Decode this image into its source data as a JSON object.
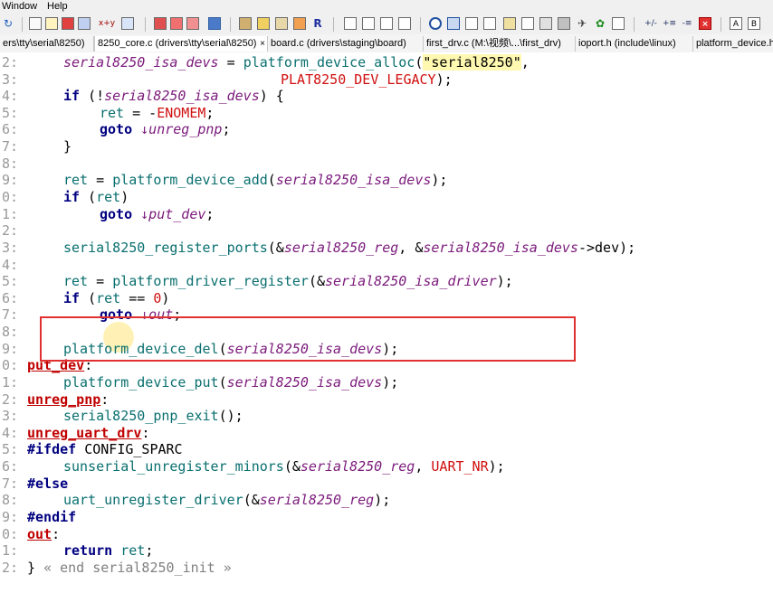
{
  "menu": {
    "items": [
      "Window",
      "Help"
    ]
  },
  "toolbar": {
    "redo_glyph": "↻",
    "swap_label": "x+y",
    "sort_label": "+/-",
    "text_a": "A",
    "text_b": "B"
  },
  "tabs": [
    {
      "label": "ers\\tty\\serial\\8250)"
    },
    {
      "label": "8250_core.c (drivers\\tty\\serial\\8250)",
      "close": "×"
    },
    {
      "label": "board.c (drivers\\staging\\board)"
    },
    {
      "label": "first_drv.c (M:\\视频\\...\\first_drv)"
    },
    {
      "label": "ioport.h (include\\linux)"
    },
    {
      "label": "platform_device.h"
    }
  ],
  "gutter": [
    "2:",
    "3:",
    "4:",
    "5:",
    "6:",
    "7:",
    "8:",
    "9:",
    "0:",
    "1:",
    "2:",
    "3:",
    "4:",
    "5:",
    "6:",
    "7:",
    "8:",
    "9:",
    "0:",
    "1:",
    "2:",
    "3:",
    "4:",
    "5:",
    "6:",
    "7:",
    "8:",
    "9:",
    "0:",
    "1:",
    "2:"
  ],
  "code": {
    "l1": {
      "a": "serial8250_isa_devs",
      "b": " = ",
      "c": "platform_device_alloc",
      "d": "(",
      "e": "\"serial8250\"",
      "f": ","
    },
    "l2": {
      "a": "PLAT8250_DEV_LEGACY",
      "b": ");"
    },
    "l3": {
      "a": "if",
      "b": " (!",
      "c": "serial8250_isa_devs",
      "d": ") {"
    },
    "l4": {
      "a": "ret",
      "b": " = -",
      "c": "ENOMEM",
      "d": ";"
    },
    "l5": {
      "a": "goto",
      "b": " ↓unreg_pnp",
      "c": ";"
    },
    "l6": {
      "a": "}"
    },
    "l8": {
      "a": "ret",
      "b": " = ",
      "c": "platform_device_add",
      "d": "(",
      "e": "serial8250_isa_devs",
      "f": ");"
    },
    "l9": {
      "a": "if",
      "b": " (",
      "c": "ret",
      "d": ")"
    },
    "l10": {
      "a": "goto",
      "b": " ↓put_dev",
      "c": ";"
    },
    "l12": {
      "a": "serial8250_register_ports",
      "b": "(&",
      "c": "serial8250_reg",
      "d": ", &",
      "e": "serial8250_isa_devs",
      "f": "->dev);"
    },
    "l14": {
      "a": "ret",
      "b": " = ",
      "c": "platform_driver_register",
      "d": "(&",
      "e": "serial8250_isa_driver",
      "f": ");"
    },
    "l15": {
      "a": "if",
      "b": " (",
      "c": "ret",
      "d": " == ",
      "e": "0",
      "f": ")"
    },
    "l16": {
      "a": "goto",
      "b": " ↓out",
      "c": ";"
    },
    "l18": {
      "a": "platform_device_del",
      "b": "(",
      "c": "serial8250_isa_devs",
      "d": ");"
    },
    "l19": {
      "a": "put_dev",
      "b": ":"
    },
    "l20": {
      "a": "platform_device_put",
      "b": "(",
      "c": "serial8250_isa_devs",
      "d": ");"
    },
    "l21": {
      "a": "unreg_pnp",
      "b": ":"
    },
    "l22": {
      "a": "serial8250_pnp_exit",
      "b": "();"
    },
    "l23": {
      "a": "unreg_uart_drv",
      "b": ":"
    },
    "l24": {
      "a": "#ifdef",
      "b": " CONFIG_SPARC"
    },
    "l25": {
      "a": "sunserial_unregister_minors",
      "b": "(&",
      "c": "serial8250_reg",
      "d": ", ",
      "e": "UART_NR",
      "f": ");"
    },
    "l26": {
      "a": "#else"
    },
    "l27": {
      "a": "uart_unregister_driver",
      "b": "(&",
      "c": "serial8250_reg",
      "d": ");"
    },
    "l28": {
      "a": "#endif"
    },
    "l29": {
      "a": "out",
      "b": ":"
    },
    "l30": {
      "a": "return",
      "b": " ",
      "c": "ret",
      "d": ";"
    },
    "l31": {
      "a": "} ",
      "b": "« end serial8250_init »"
    }
  },
  "colors": {
    "highlight_box": "#e03030",
    "label_red": "#c00000",
    "function_teal": "#0a6f6f",
    "param_purple": "#7b1a7b",
    "keyword_navy": "#000080"
  }
}
